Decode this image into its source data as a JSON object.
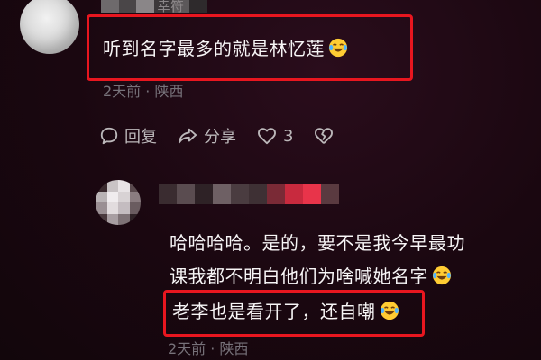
{
  "comment1": {
    "username_partial": "幸符",
    "text": "听到名字最多的就是林忆莲",
    "emoji": "laughing-tears-emoji",
    "meta": "2天前 · 陕西",
    "actions": {
      "reply": "回复",
      "share": "分享",
      "like_count": "3"
    }
  },
  "reply": {
    "lines": [
      "哈哈哈哈。是的，要不是我今早最功",
      "课我都不明白他们为啥喊她名字",
      "老李也是看开了，还自嘲"
    ],
    "emoji": "laughing-tears-emoji",
    "meta": "2天前 · 陕西"
  },
  "colors": {
    "highlight": "#e8161f",
    "background": "#1a0710",
    "text": "#f7f5f6",
    "meta": "#77727a",
    "action": "#bcb8ba"
  }
}
